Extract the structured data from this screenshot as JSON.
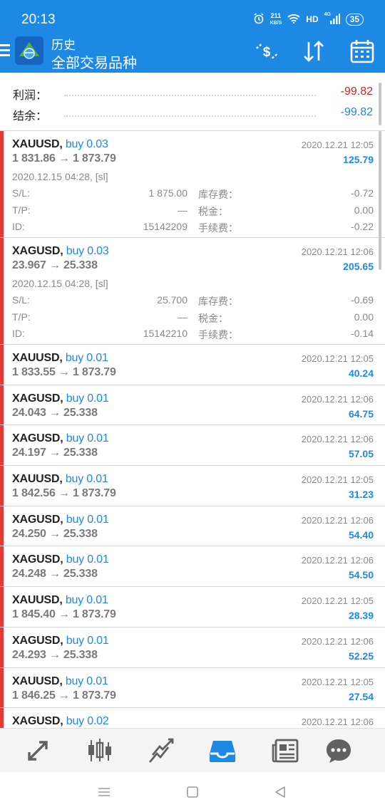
{
  "status_bar": {
    "time": "20:13",
    "speed_value": "211",
    "speed_unit": "KB/S",
    "network_hd": "HD",
    "network_gen": "4G",
    "battery": "35"
  },
  "app_bar": {
    "subtitle": "历史",
    "title": "全部交易品种",
    "icons": [
      "menu-icon",
      "metatrader-logo",
      "deposit-withdraw-icon",
      "sort-icon",
      "calendar-icon"
    ]
  },
  "summary": {
    "profit_label": "利润：",
    "profit_value": "-99.82",
    "balance_label": "结余：",
    "balance_value": "-99.82"
  },
  "colors": {
    "brand_blue": "#1e88e5",
    "loss_red": "#e53935",
    "balance_blue": "#1e88e5"
  },
  "labels": {
    "sl": "S/L:",
    "tp": "T/P:",
    "id": "ID:",
    "swap": "库存费：",
    "tax": "税金：",
    "commission": "手续费："
  },
  "trades": [
    {
      "symbol": "XAUUSD,",
      "side": "buy 0.03",
      "datetime": "2020.12.21 12:05",
      "prices": "1 831.86 → 1 873.79",
      "profit": "125.79",
      "expanded": true,
      "open_info": "2020.12.15 04:28, [sl]",
      "sl_value": "1 875.00",
      "tp_value": "—",
      "id_value": "15142209",
      "swap_value": "-0.72",
      "tax_value": "0.00",
      "commission_value": "-0.22"
    },
    {
      "symbol": "XAGUSD,",
      "side": "buy 0.03",
      "datetime": "2020.12.21 12:06",
      "prices": "23.967 → 25.338",
      "profit": "205.65",
      "expanded": true,
      "open_info": "2020.12.15 04:28, [sl]",
      "sl_value": "25.700",
      "tp_value": "—",
      "id_value": "15142210",
      "swap_value": "-0.69",
      "tax_value": "0.00",
      "commission_value": "-0.14"
    },
    {
      "symbol": "XAUUSD,",
      "side": "buy 0.01",
      "datetime": "2020.12.21 12:05",
      "prices": "1 833.55 → 1 873.79",
      "profit": "40.24"
    },
    {
      "symbol": "XAGUSD,",
      "side": "buy 0.01",
      "datetime": "2020.12.21 12:06",
      "prices": "24.043 → 25.338",
      "profit": "64.75"
    },
    {
      "symbol": "XAGUSD,",
      "side": "buy 0.01",
      "datetime": "2020.12.21 12:06",
      "prices": "24.197 → 25.338",
      "profit": "57.05"
    },
    {
      "symbol": "XAUUSD,",
      "side": "buy 0.01",
      "datetime": "2020.12.21 12:05",
      "prices": "1 842.56 → 1 873.79",
      "profit": "31.23"
    },
    {
      "symbol": "XAGUSD,",
      "side": "buy 0.01",
      "datetime": "2020.12.21 12:06",
      "prices": "24.250 → 25.338",
      "profit": "54.40"
    },
    {
      "symbol": "XAGUSD,",
      "side": "buy 0.01",
      "datetime": "2020.12.21 12:06",
      "prices": "24.248 → 25.338",
      "profit": "54.50"
    },
    {
      "symbol": "XAUUSD,",
      "side": "buy 0.01",
      "datetime": "2020.12.21 12:05",
      "prices": "1 845.40 → 1 873.79",
      "profit": "28.39"
    },
    {
      "symbol": "XAGUSD,",
      "side": "buy 0.01",
      "datetime": "2020.12.21 12:06",
      "prices": "24.293 → 25.338",
      "profit": "52.25"
    },
    {
      "symbol": "XAUUSD,",
      "side": "buy 0.01",
      "datetime": "2020.12.21 12:05",
      "prices": "1 846.25 → 1 873.79",
      "profit": "27.54"
    },
    {
      "symbol": "XAGUSD,",
      "side": "buy 0.02",
      "datetime": "2020.12.21 12:06",
      "prices": "",
      "profit": ""
    }
  ],
  "bottom_nav": {
    "items": [
      "quotes-icon",
      "chart-icon",
      "trade-icon",
      "history-icon",
      "news-icon",
      "chat-icon"
    ],
    "active": "history-icon"
  },
  "system_nav": [
    "recent-apps-icon",
    "home-icon",
    "back-icon"
  ]
}
